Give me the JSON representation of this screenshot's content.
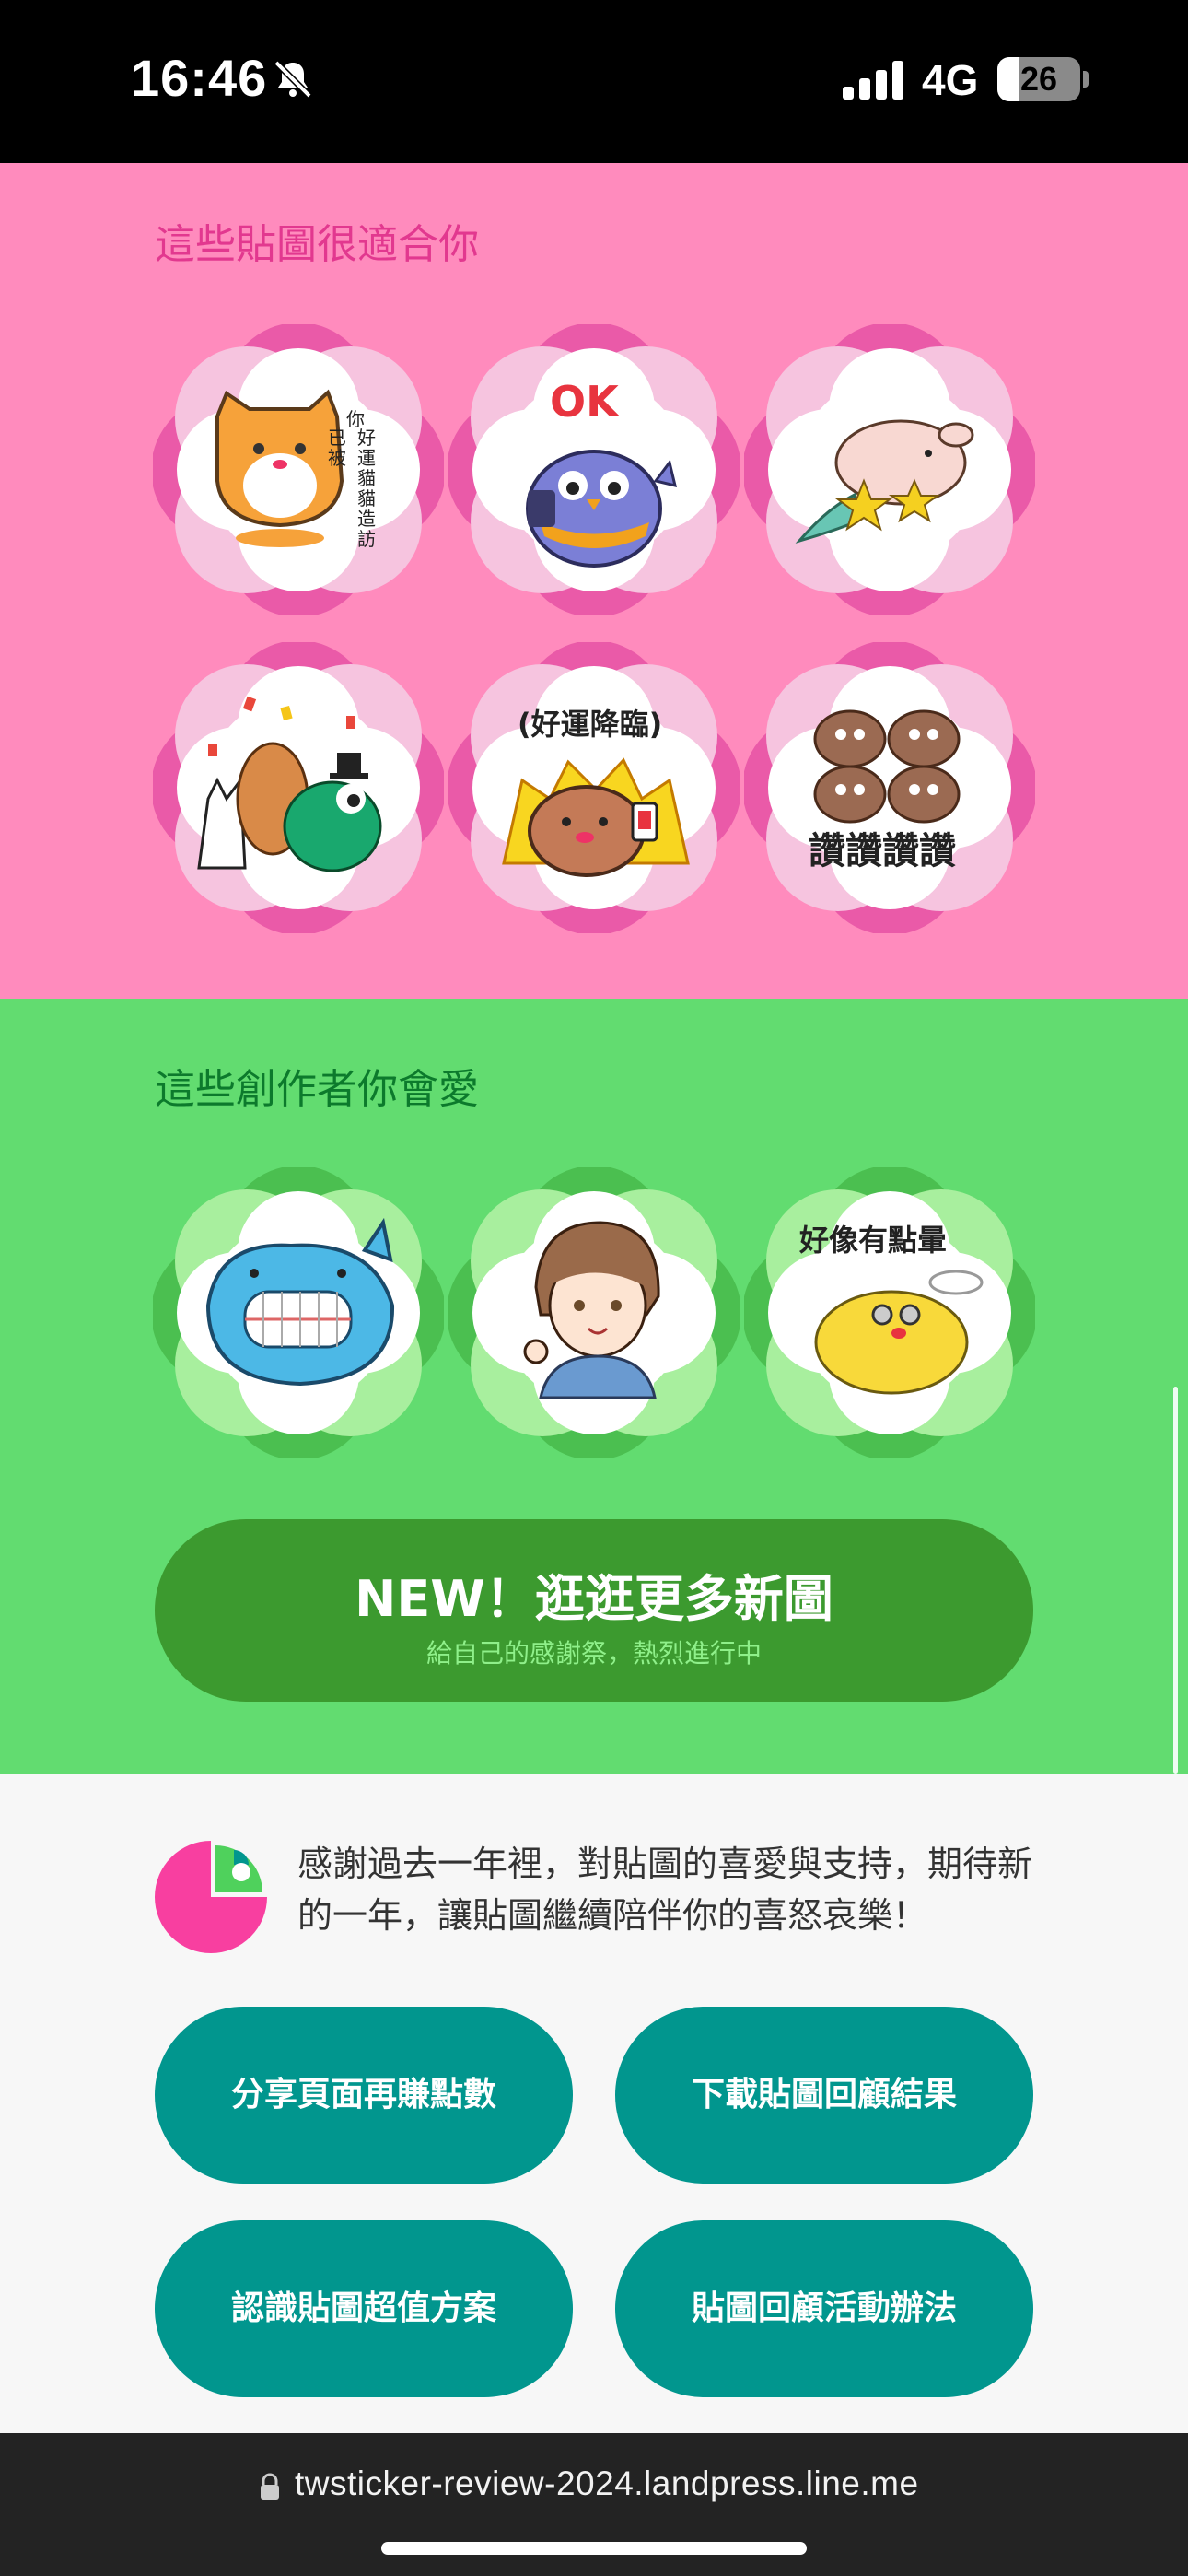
{
  "status_bar": {
    "time": "16:46",
    "network": "4G",
    "battery": "26",
    "battery_level": 0.26,
    "icons": [
      "bell-slash-icon",
      "signal-icon",
      "battery-icon"
    ]
  },
  "recommended_stickers": {
    "title": "這些貼圖很適合你",
    "items": [
      {
        "name": "orange-cat-sticker",
        "caption": "你已被好運貓貓造訪"
      },
      {
        "name": "blue-bird-ok-sticker",
        "caption": "OK"
      },
      {
        "name": "mermaid-pig-sticker",
        "caption": ""
      },
      {
        "name": "animal-group-sticker",
        "caption": ""
      },
      {
        "name": "lucky-bear-sticker",
        "caption": "(好運降臨)"
      },
      {
        "name": "praise-potato-sticker",
        "caption": "讚讚讚讚"
      }
    ],
    "colors": {
      "background": "#ff8bbd",
      "flower": "#ea5aa8",
      "title": "#e2388f"
    }
  },
  "recommended_creators": {
    "title": "這些創作者你會愛",
    "items": [
      {
        "name": "blue-shark-creator",
        "caption": ""
      },
      {
        "name": "anime-boy-creator",
        "caption": ""
      },
      {
        "name": "yellow-chick-creator",
        "caption": "好像有點暈"
      }
    ],
    "colors": {
      "background": "#62dc70",
      "flower": "#4bbf50",
      "title": "#0c7a2c"
    }
  },
  "cta": {
    "title": "NEW！逛逛更多新圖",
    "subtitle": "給自己的感謝祭，熱烈進行中",
    "color": "#3c9a2f"
  },
  "footer": {
    "thanks_text": "感謝過去一年裡，對貼圖的喜愛與支持，期待新的一年，讓貼圖繼續陪伴你的喜怒哀樂！",
    "buttons": [
      {
        "label": "分享頁面再賺點數"
      },
      {
        "label": "下載貼圖回顧結果"
      },
      {
        "label": "認識貼圖超值方案"
      },
      {
        "label": "貼圖回顧活動辦法"
      }
    ],
    "button_color": "#01968e"
  },
  "browser": {
    "url": "twsticker-review-2024.landpress.line.me"
  }
}
